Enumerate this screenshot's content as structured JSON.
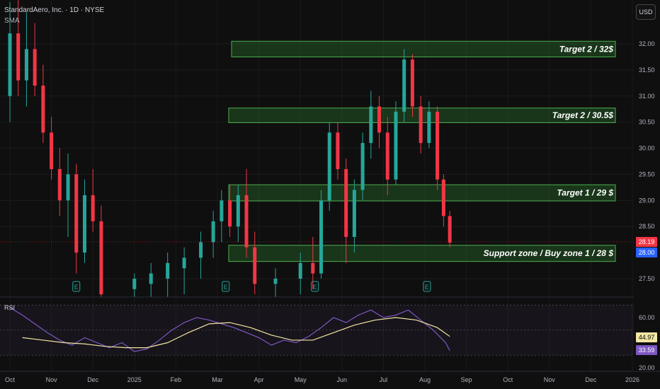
{
  "header": {
    "title": "StandardAero, Inc. · 1D · NYSE",
    "indicator": "SMA"
  },
  "currency": "USD",
  "rsi_label": "RSI",
  "price_axis": {
    "ticks": [
      "32.00",
      "31.50",
      "31.00",
      "30.50",
      "30.00",
      "29.50",
      "29.00",
      "28.50",
      "27.50"
    ],
    "tick_values": [
      32.0,
      31.5,
      31.0,
      30.5,
      30.0,
      29.5,
      29.0,
      28.5,
      27.5
    ],
    "current_price": "28.19",
    "current_price_color": "#f23645",
    "support_price": "28.00",
    "support_price_color": "#2962ff"
  },
  "rsi_axis": {
    "ticks": [
      "60.00",
      "20.00"
    ],
    "tick_values": [
      60,
      20
    ],
    "rsi_ma_value": "44.97",
    "rsi_ma_color": "#f3e6a3",
    "rsi_value": "33.59",
    "rsi_color": "#7e57c2"
  },
  "time_axis": [
    "Oct",
    "Nov",
    "Dec",
    "2025",
    "Feb",
    "Mar",
    "Apr",
    "May",
    "Jun",
    "Jul",
    "Aug",
    "Sep",
    "Oct",
    "Nov",
    "Dec",
    "2026"
  ],
  "zones": [
    {
      "label": "Target 2 / 32$",
      "low": 31.75,
      "high": 32.05
    },
    {
      "label": "Target 2 / 30.5$",
      "low": 30.49,
      "high": 30.77
    },
    {
      "label": "Target 1 / 29 $",
      "low": 28.99,
      "high": 29.3
    },
    {
      "label": "Support zone / Buy zone 1 / 28 $",
      "low": 27.83,
      "high": 28.14
    }
  ],
  "event_markers": [
    {
      "label": "E",
      "date_index": 1.6
    },
    {
      "label": "E",
      "date_index": 5.2
    },
    {
      "label": "E",
      "date_index": 7.35
    },
    {
      "label": "E",
      "date_index": 10.05
    }
  ],
  "colors": {
    "up": "#26a69a",
    "down": "#f23645",
    "zone_fill": "#2e7d32",
    "zone_border": "#4caf50",
    "rsi_line": "#7e57c2",
    "rsi_ma": "#f3e6a3"
  },
  "chart_data": {
    "type": "candlestick",
    "title": "StandardAero, Inc. · 1D · NYSE",
    "x_unit": "approximate months from Oct 2024",
    "ylim": [
      27.2,
      32.3
    ],
    "price_series": [
      {
        "t": 0.0,
        "o": 31.0,
        "h": 32.8,
        "l": 30.5,
        "c": 32.2
      },
      {
        "t": 0.2,
        "o": 32.2,
        "h": 32.9,
        "l": 31.0,
        "c": 31.3
      },
      {
        "t": 0.4,
        "o": 31.3,
        "h": 32.6,
        "l": 30.8,
        "c": 31.9
      },
      {
        "t": 0.6,
        "o": 31.9,
        "h": 32.4,
        "l": 31.0,
        "c": 31.2
      },
      {
        "t": 0.8,
        "o": 31.2,
        "h": 31.6,
        "l": 30.1,
        "c": 30.3
      },
      {
        "t": 1.0,
        "o": 30.3,
        "h": 30.6,
        "l": 29.4,
        "c": 29.6
      },
      {
        "t": 1.2,
        "o": 29.6,
        "h": 30.0,
        "l": 28.7,
        "c": 29.0
      },
      {
        "t": 1.4,
        "o": 29.0,
        "h": 29.9,
        "l": 28.3,
        "c": 29.5
      },
      {
        "t": 1.6,
        "o": 29.5,
        "h": 29.7,
        "l": 27.6,
        "c": 28.0
      },
      {
        "t": 1.8,
        "o": 28.0,
        "h": 29.4,
        "l": 27.8,
        "c": 29.1
      },
      {
        "t": 2.0,
        "o": 29.1,
        "h": 29.6,
        "l": 28.4,
        "c": 28.6
      },
      {
        "t": 2.2,
        "o": 28.6,
        "h": 28.9,
        "l": 27.0,
        "c": 27.2
      },
      {
        "t": 3.0,
        "o": 27.3,
        "h": 27.6,
        "l": 27.0,
        "c": 27.5
      },
      {
        "t": 3.4,
        "o": 27.4,
        "h": 27.8,
        "l": 27.0,
        "c": 27.6
      },
      {
        "t": 3.8,
        "o": 27.5,
        "h": 28.0,
        "l": 27.1,
        "c": 27.8
      },
      {
        "t": 4.2,
        "o": 27.7,
        "h": 28.1,
        "l": 27.2,
        "c": 27.9
      },
      {
        "t": 4.6,
        "o": 27.9,
        "h": 28.4,
        "l": 27.5,
        "c": 28.2
      },
      {
        "t": 4.9,
        "o": 28.2,
        "h": 28.8,
        "l": 27.9,
        "c": 28.6
      },
      {
        "t": 5.1,
        "o": 28.6,
        "h": 29.2,
        "l": 28.2,
        "c": 29.0
      },
      {
        "t": 5.3,
        "o": 29.0,
        "h": 29.3,
        "l": 28.3,
        "c": 28.5
      },
      {
        "t": 5.5,
        "o": 28.5,
        "h": 29.3,
        "l": 28.2,
        "c": 29.1
      },
      {
        "t": 5.7,
        "o": 29.1,
        "h": 29.6,
        "l": 27.9,
        "c": 28.1
      },
      {
        "t": 5.9,
        "o": 28.1,
        "h": 28.4,
        "l": 27.2,
        "c": 27.4
      },
      {
        "t": 6.4,
        "o": 27.4,
        "h": 27.7,
        "l": 27.1,
        "c": 27.5
      },
      {
        "t": 7.0,
        "o": 27.5,
        "h": 28.0,
        "l": 27.2,
        "c": 27.8
      },
      {
        "t": 7.3,
        "o": 27.8,
        "h": 28.3,
        "l": 27.3,
        "c": 27.6
      },
      {
        "t": 7.5,
        "o": 27.6,
        "h": 29.2,
        "l": 27.5,
        "c": 29.0
      },
      {
        "t": 7.7,
        "o": 29.0,
        "h": 30.5,
        "l": 28.8,
        "c": 30.3
      },
      {
        "t": 7.9,
        "o": 30.3,
        "h": 30.5,
        "l": 29.4,
        "c": 29.6
      },
      {
        "t": 8.1,
        "o": 29.6,
        "h": 29.8,
        "l": 27.8,
        "c": 28.3
      },
      {
        "t": 8.3,
        "o": 28.3,
        "h": 29.4,
        "l": 28.0,
        "c": 29.2
      },
      {
        "t": 8.5,
        "o": 29.2,
        "h": 30.3,
        "l": 29.0,
        "c": 30.1
      },
      {
        "t": 8.7,
        "o": 30.1,
        "h": 31.1,
        "l": 29.8,
        "c": 30.8
      },
      {
        "t": 8.9,
        "o": 30.8,
        "h": 31.0,
        "l": 30.0,
        "c": 30.3
      },
      {
        "t": 9.1,
        "o": 30.3,
        "h": 30.6,
        "l": 29.1,
        "c": 29.4
      },
      {
        "t": 9.3,
        "o": 29.4,
        "h": 30.9,
        "l": 29.3,
        "c": 30.7
      },
      {
        "t": 9.5,
        "o": 30.7,
        "h": 31.9,
        "l": 30.5,
        "c": 31.7
      },
      {
        "t": 9.7,
        "o": 31.7,
        "h": 31.8,
        "l": 30.6,
        "c": 30.8
      },
      {
        "t": 9.9,
        "o": 30.8,
        "h": 31.0,
        "l": 29.9,
        "c": 30.1
      },
      {
        "t": 10.1,
        "o": 30.1,
        "h": 30.9,
        "l": 30.0,
        "c": 30.7
      },
      {
        "t": 10.3,
        "o": 30.7,
        "h": 30.8,
        "l": 29.2,
        "c": 29.4
      },
      {
        "t": 10.45,
        "o": 29.4,
        "h": 29.5,
        "l": 28.5,
        "c": 28.7
      },
      {
        "t": 10.6,
        "o": 28.7,
        "h": 28.8,
        "l": 28.1,
        "c": 28.19
      }
    ],
    "rsi": {
      "label": "RSI",
      "lines_at": [
        70,
        50,
        30
      ],
      "values": [
        [
          0.0,
          68
        ],
        [
          0.3,
          62
        ],
        [
          0.6,
          55
        ],
        [
          0.9,
          48
        ],
        [
          1.2,
          42
        ],
        [
          1.5,
          38
        ],
        [
          1.8,
          44
        ],
        [
          2.1,
          40
        ],
        [
          2.4,
          36
        ],
        [
          2.7,
          40
        ],
        [
          3.0,
          33
        ],
        [
          3.3,
          35
        ],
        [
          3.6,
          42
        ],
        [
          3.9,
          50
        ],
        [
          4.2,
          56
        ],
        [
          4.5,
          60
        ],
        [
          4.8,
          58
        ],
        [
          5.1,
          55
        ],
        [
          5.4,
          52
        ],
        [
          5.7,
          48
        ],
        [
          6.0,
          44
        ],
        [
          6.3,
          38
        ],
        [
          6.6,
          42
        ],
        [
          6.9,
          40
        ],
        [
          7.2,
          45
        ],
        [
          7.5,
          52
        ],
        [
          7.8,
          60
        ],
        [
          8.1,
          56
        ],
        [
          8.4,
          62
        ],
        [
          8.7,
          66
        ],
        [
          9.0,
          60
        ],
        [
          9.3,
          62
        ],
        [
          9.6,
          66
        ],
        [
          9.9,
          58
        ],
        [
          10.2,
          50
        ],
        [
          10.5,
          40
        ],
        [
          10.6,
          33.59
        ]
      ],
      "ma": [
        [
          0.3,
          44
        ],
        [
          0.8,
          42
        ],
        [
          1.3,
          40
        ],
        [
          1.8,
          39
        ],
        [
          2.3,
          37
        ],
        [
          2.8,
          36
        ],
        [
          3.3,
          36
        ],
        [
          3.8,
          40
        ],
        [
          4.3,
          48
        ],
        [
          4.8,
          55
        ],
        [
          5.3,
          56
        ],
        [
          5.8,
          52
        ],
        [
          6.3,
          46
        ],
        [
          6.8,
          42
        ],
        [
          7.3,
          42
        ],
        [
          7.8,
          48
        ],
        [
          8.3,
          54
        ],
        [
          8.8,
          58
        ],
        [
          9.3,
          60
        ],
        [
          9.8,
          58
        ],
        [
          10.3,
          52
        ],
        [
          10.6,
          44.97
        ]
      ],
      "ylim": [
        20,
        75
      ]
    }
  }
}
